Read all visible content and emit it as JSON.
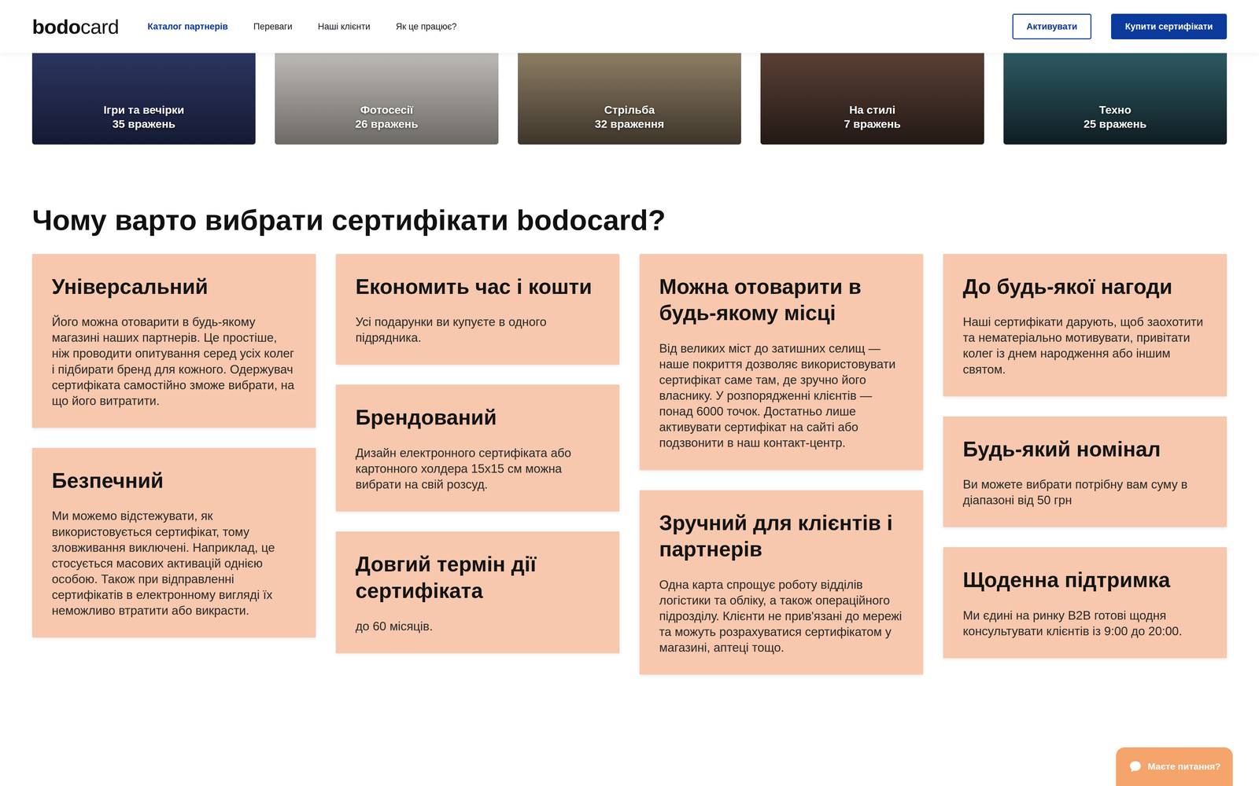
{
  "header": {
    "logo": {
      "bold": "bodo",
      "light": "card"
    },
    "nav": [
      {
        "label": "Каталог партнерів",
        "selected": true
      },
      {
        "label": "Переваги",
        "selected": false
      },
      {
        "label": "Наші клієнти",
        "selected": false
      },
      {
        "label": "Як це працює?",
        "selected": false
      }
    ],
    "buttons": {
      "activate": "Активувати",
      "buy": "Купити сертифікати"
    }
  },
  "categories": [
    {
      "title": "Ігри та вечірки",
      "count": "35 вражень"
    },
    {
      "title": "Фотосесії",
      "count": "26 вражень"
    },
    {
      "title": "Стрільба",
      "count": "32 враження"
    },
    {
      "title": "На стилі",
      "count": "7 вражень"
    },
    {
      "title": "Техно",
      "count": "25 вражень"
    }
  ],
  "benefits": {
    "title": "Чому варто вибрати сертифікати bodocard?",
    "columns": [
      [
        {
          "title": "Універсальний",
          "text": "Його можна отоварити в будь-якому магазині наших партнерів. Це простіше, ніж проводити опитування серед усіх колег і підбирати бренд для кожного. Одержувач сертифіката самостійно зможе вибрати, на що його витратити."
        },
        {
          "title": "Безпечний",
          "text": "Ми можемо відстежувати, як використовується сертифікат, тому зловживання виключені. Наприклад, це стосується масових активацій однією особою. Також при відправленні сертифікатів в електронному вигляді їх неможливо втратити або викрасти."
        }
      ],
      [
        {
          "title": "Економить час і кошти",
          "text": "Усі подарунки ви купуєте в одного підрядника."
        },
        {
          "title": "Брендований",
          "text": "Дизайн електронного сертифіката або картонного холдера 15х15 см можна вибрати на свій розсуд."
        },
        {
          "title": "Довгий термін дії сертифіката",
          "text": "до 60 місяців."
        }
      ],
      [
        {
          "title": "Можна отоварити в будь-якому місці",
          "text": "Від великих міст до затишних селищ — наше покриття дозволяє використовувати сертифікат саме там, де зручно його власнику. У розпорядженні клієнтів — понад 6000 точок. Достатньо лише активувати сертифікат на сайті або подзвонити в наш контакт-центр."
        },
        {
          "title": "Зручний для клієнтів і партнерів",
          "text": "Одна карта спрощує роботу відділів логістики та обліку, а також операційного підрозділу. Клієнти не прив'язані до мережі та можуть розрахуватися сертифікатом у магазині, аптеці тощо."
        }
      ],
      [
        {
          "title": "До будь-якої нагоди",
          "text": "Наші сертифікати дарують, щоб заохотити та нематеріально мотивувати, привітати колег із днем народження або іншим святом."
        },
        {
          "title": "Будь-який номінал",
          "text": "Ви можете вибрати потрібну вам суму в діапазоні від 50 грн"
        },
        {
          "title": "Щоденна підтримка",
          "text": "Ми єдині на ринку B2B готові щодня консультувати клієнтів із 9:00 до 20:00."
        }
      ]
    ]
  },
  "chat": {
    "label": "Маєте питання?"
  }
}
